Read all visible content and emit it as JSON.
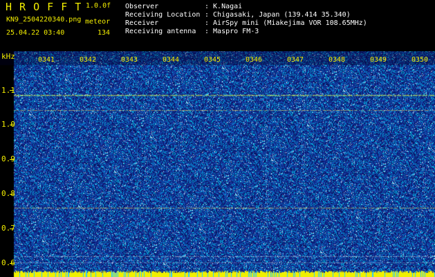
{
  "app": {
    "title": "H R O F F T",
    "version": "1.0.0f",
    "filename": "KN9_2504220340.png",
    "timestamp": "25.04.22 03:40",
    "mode_label": "meteor",
    "count": "134"
  },
  "info": [
    {
      "label": "Observer",
      "value": ": K.Nagai"
    },
    {
      "label": "Receiving Location",
      "value": ": Chigasaki, Japan (139.414 35.340)"
    },
    {
      "label": "Receiver",
      "value": ": AirSpy mini (Miakejima VOR 108.65MHz)"
    },
    {
      "label": "Receiving antenna",
      "value": ": Maspro FM-3"
    }
  ],
  "spectrogram": {
    "y_unit": "kHz",
    "y_ticks": [
      "1.1",
      "1.0",
      "0.9",
      "0.8",
      "0.7",
      "0.6"
    ],
    "time_ticks": [
      "0341",
      "0342",
      "0343",
      "0344",
      "0345",
      "0346",
      "0347",
      "0348",
      "0349",
      "0350"
    ],
    "colors": {
      "background": "#14288c",
      "noise_bright": "#00d0ff",
      "signal": "#f0f000",
      "axis": "#f4ef00"
    }
  }
}
